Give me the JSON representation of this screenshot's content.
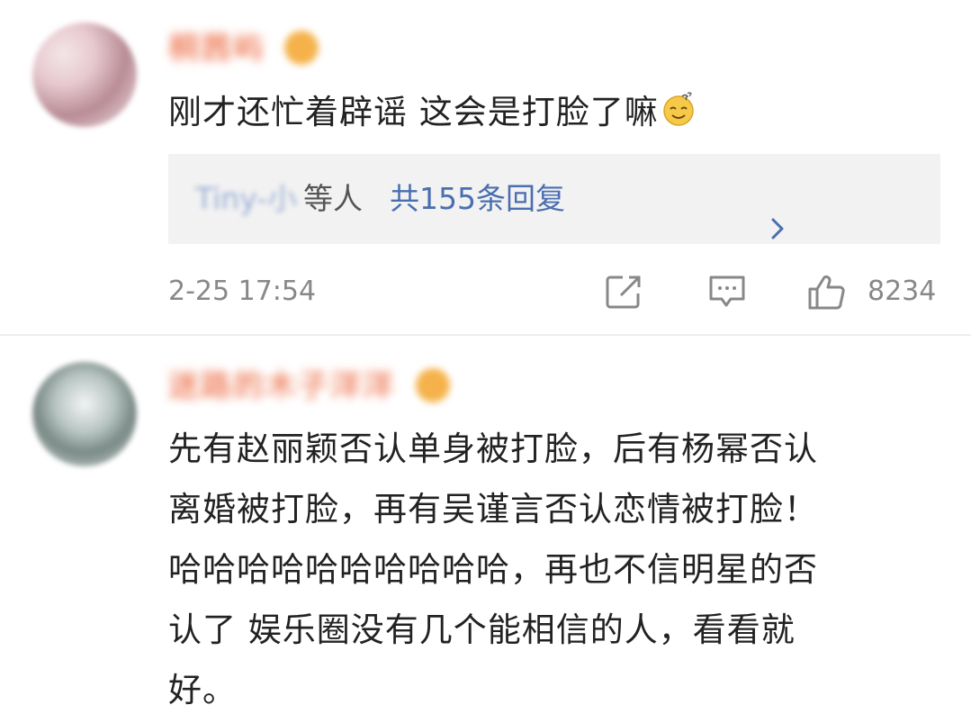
{
  "comments": [
    {
      "username": "桐茜屿",
      "text": "刚才还忙着辟谣 这会是打脸了嘛",
      "emoji": "dizzy-smile-emoji",
      "replies": {
        "users": "Tiny-小",
        "etc_label": "等人",
        "link_label": "共155条回复"
      },
      "timestamp": "2-25 17:54",
      "like_count": "8234"
    },
    {
      "username": "迷路的木子洋洋",
      "lines": [
        "先有赵丽颖否认单身被打脸，后有杨幂否认",
        "离婚被打脸，再有吴谨言否认恋情被打脸！",
        "哈哈哈哈哈哈哈哈哈哈，再也不信明星的否",
        "认了 娱乐圈没有几个能相信的人，看看就",
        "好。"
      ]
    }
  ],
  "colors": {
    "link": "#4a6fb0",
    "meta": "#888888",
    "text": "#222222",
    "reply_bg": "#f2f2f2"
  },
  "icons": [
    "share-icon",
    "comment-icon",
    "like-icon",
    "chevron-right-icon",
    "vip-badge-icon"
  ]
}
